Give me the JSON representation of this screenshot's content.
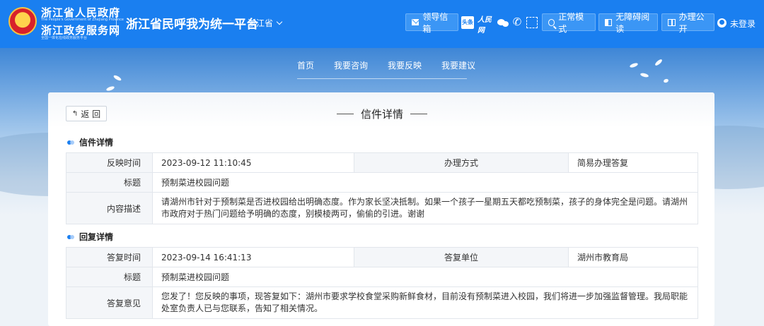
{
  "header": {
    "gov_name": "浙江省人民政府",
    "gov_name_en": "The People's Government of Zhejiang Province",
    "service_name": "浙江政务服务网",
    "service_tagline": "全国一体化在线政务服务平台",
    "platform_title": "浙江省民呼我为统一平台",
    "region": "浙江省",
    "leader_mailbox": "领导信箱",
    "toutiao_label": "头条",
    "renminwang_label": "人民网",
    "normal_mode": "正常模式",
    "accessible_reading": "无障碍阅读",
    "office_public": "办理公开",
    "login": "未登录"
  },
  "nav": {
    "items": [
      "首页",
      "我要咨询",
      "我要反映",
      "我要建议"
    ]
  },
  "page": {
    "back_label": "返 回",
    "title": "信件详情"
  },
  "letter": {
    "section_title": "信件详情",
    "time_label": "反映时间",
    "time_value": "2023-09-12 11:10:45",
    "method_label": "办理方式",
    "method_value": "简易办理答复",
    "subject_label": "标题",
    "subject_value": "预制菜进校园问题",
    "content_label": "内容描述",
    "content_value": "请湖州市针对于预制菜是否进校园给出明确态度。作为家长坚决抵制。如果一个孩子一星期五天都吃预制菜，孩子的身体完全是问题。请湖州市政府对于热门问题给予明确的态度，别模棱两可，偷偷的引进。谢谢"
  },
  "reply": {
    "section_title": "回复详情",
    "time_label": "答复时间",
    "time_value": "2023-09-14 16:41:13",
    "unit_label": "答复单位",
    "unit_value": "湖州市教育局",
    "subject_label": "标题",
    "subject_value": "预制菜进校园问题",
    "opinion_label": "答复意见",
    "opinion_value": "您发了！您反映的事项，现答复如下：湖州市要求学校食堂采购新鲜食材，目前没有预制菜进入校园，我们将进一步加强监督管理。我局职能处室负责人已与您联系，告知了相关情况。"
  },
  "colors": {
    "brand_blue": "#1a7ff0",
    "button_blue": "#3b96f5",
    "label_bg": "#f4f6f9"
  }
}
